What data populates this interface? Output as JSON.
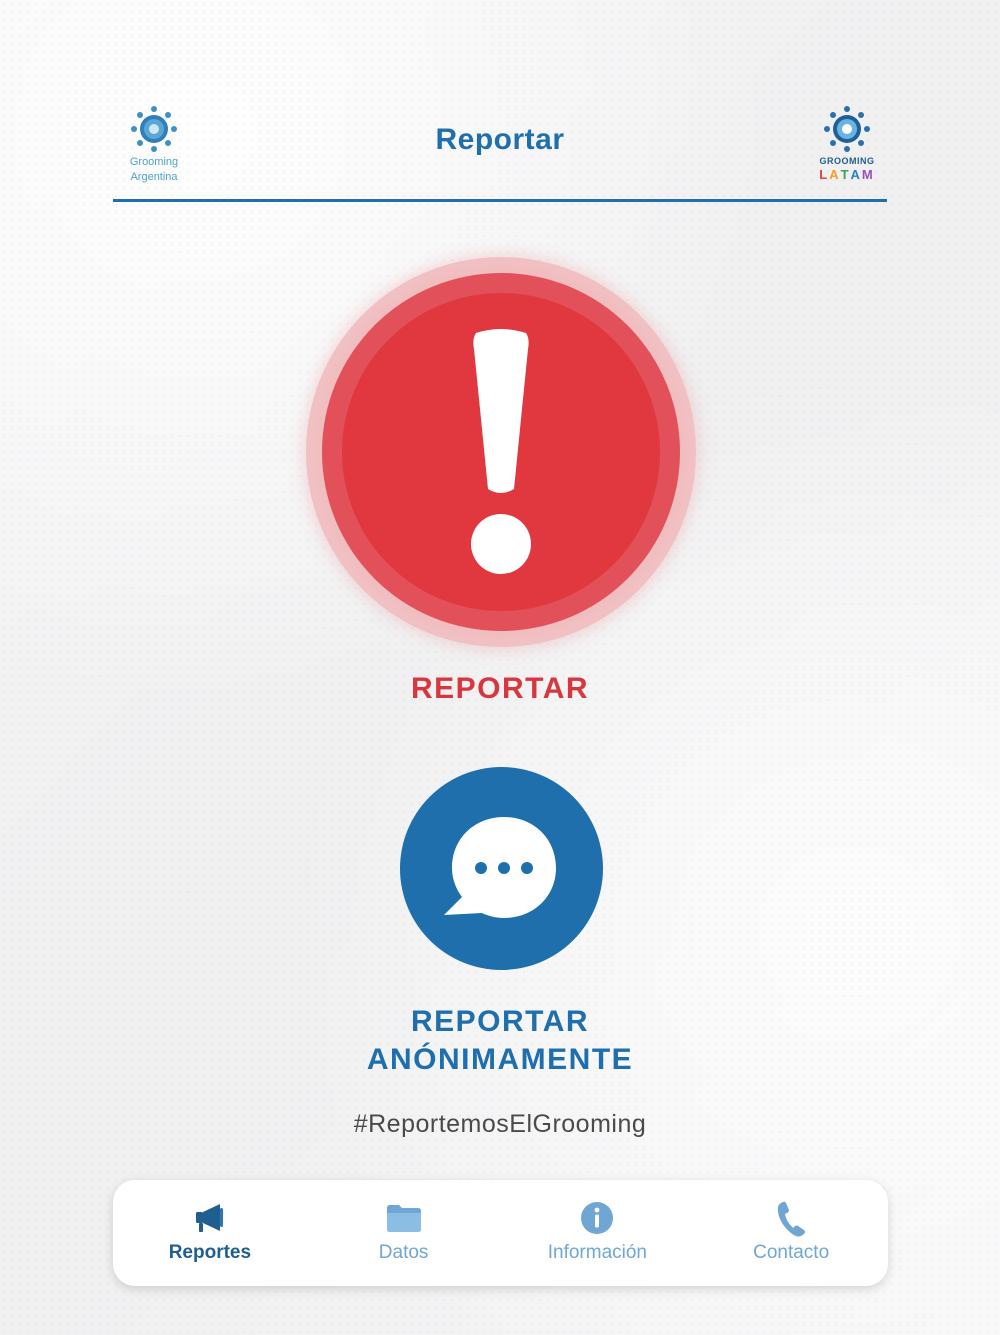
{
  "header": {
    "title": "Reportar",
    "left_logo": {
      "line1": "Grooming",
      "line2": "Argentina"
    },
    "right_logo": {
      "top": "GROOMING",
      "bottom": [
        "L",
        "A",
        "T",
        "A",
        "M"
      ]
    }
  },
  "main": {
    "report_label": "REPORTAR",
    "anon_label_line1": "REPORTAR",
    "anon_label_line2": "ANÓNIMAMENTE",
    "hashtag": "#ReportemosElGrooming"
  },
  "tabbar": {
    "items": [
      {
        "label": "Reportes",
        "icon": "megaphone-icon",
        "active": true
      },
      {
        "label": "Datos",
        "icon": "folder-icon",
        "active": false
      },
      {
        "label": "Información",
        "icon": "info-icon",
        "active": false
      },
      {
        "label": "Contacto",
        "icon": "phone-icon",
        "active": false
      }
    ]
  },
  "colors": {
    "brand_blue": "#1f6fae",
    "alert_red": "#e1383f",
    "tab_inactive": "#6fa6d3"
  }
}
